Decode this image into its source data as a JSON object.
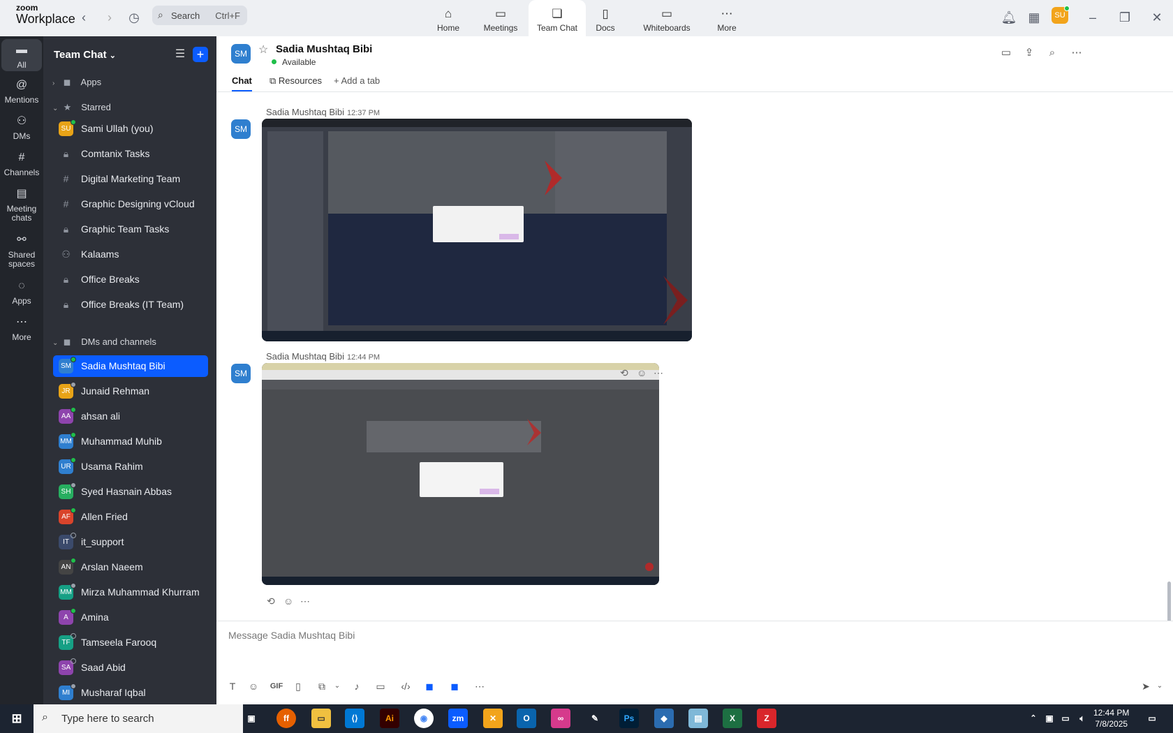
{
  "brand": {
    "line1": "zoom",
    "line2": "Workplace"
  },
  "search": {
    "label": "Search",
    "shortcut": "Ctrl+F"
  },
  "nav_tabs": [
    {
      "label": "Home"
    },
    {
      "label": "Meetings"
    },
    {
      "label": "Team Chat"
    },
    {
      "label": "Docs"
    },
    {
      "label": "Whiteboards"
    },
    {
      "label": "More"
    }
  ],
  "user_avatar": "SU",
  "rail": [
    {
      "label": "All"
    },
    {
      "label": "Mentions"
    },
    {
      "label": "DMs"
    },
    {
      "label": "Channels"
    },
    {
      "label": "Meeting chats"
    },
    {
      "label": "Shared spaces"
    },
    {
      "label": "Apps"
    },
    {
      "label": "More"
    }
  ],
  "sidebar": {
    "title": "Team Chat",
    "sections": {
      "apps": "Apps",
      "starred": "Starred",
      "dms": "DMs and channels"
    },
    "starred": [
      {
        "label": "Sami Ullah (you)",
        "initials": "SU",
        "color": "#e8a317"
      },
      {
        "label": "Comtanix Tasks",
        "icon": "lock"
      },
      {
        "label": "Digital Marketing Team",
        "icon": "hash"
      },
      {
        "label": "Graphic Designing vCloud",
        "icon": "hash"
      },
      {
        "label": "Graphic Team Tasks",
        "icon": "lock"
      },
      {
        "label": "Kalaams",
        "icon": "group"
      },
      {
        "label": "Office Breaks",
        "icon": "lock"
      },
      {
        "label": "Office Breaks (IT Team)",
        "icon": "lock"
      }
    ],
    "dms": [
      {
        "label": "Sadia Mushtaq Bibi",
        "initials": "SM",
        "color": "#2f7fcf"
      },
      {
        "label": "Junaid Rehman",
        "initials": "JR",
        "color": "#e8a317"
      },
      {
        "label": "ahsan ali",
        "initials": "AA",
        "color": "#8e44ad"
      },
      {
        "label": "Muhammad Muhib",
        "initials": "MM",
        "color": "#2f7fcf"
      },
      {
        "label": "Usama Rahim",
        "initials": "UR",
        "color": "#2f7fcf"
      },
      {
        "label": "Syed Hasnain Abbas",
        "initials": "SH",
        "color": "#27ae60"
      },
      {
        "label": "Allen Fried",
        "initials": "AF",
        "color": "#d9442b"
      },
      {
        "label": "it_support",
        "initials": "IT",
        "color": "#3b4a6b"
      },
      {
        "label": "Arslan Naeem",
        "initials": "AN",
        "color": "#444"
      },
      {
        "label": "Mirza Muhammad Khurram",
        "initials": "MM",
        "color": "#16a085"
      },
      {
        "label": "Amina",
        "initials": "A",
        "color": "#8e44ad"
      },
      {
        "label": "Tamseela Farooq",
        "initials": "TF",
        "color": "#16a085"
      },
      {
        "label": "Saad Abid",
        "initials": "SA",
        "color": "#8e44ad"
      },
      {
        "label": "Musharaf Iqbal",
        "initials": "MI",
        "color": "#2f7fcf"
      }
    ]
  },
  "channel": {
    "initials": "SM",
    "name": "Sadia Mushtaq Bibi",
    "status": "Available",
    "tabs": [
      "Chat",
      "Resources",
      "Add a tab"
    ]
  },
  "messages": [
    {
      "sender": "Sadia Mushtaq Bibi",
      "time": "12:37 PM",
      "initials": "SM"
    },
    {
      "sender": "Sadia Mushtaq Bibi",
      "time": "12:44 PM",
      "initials": "SM"
    }
  ],
  "composer": {
    "placeholder": "Message Sadia Mushtaq Bibi",
    "gif": "GIF"
  },
  "taskbar": {
    "search_placeholder": "Type here to search",
    "time": "12:44 PM",
    "date": "7/8/2025"
  }
}
